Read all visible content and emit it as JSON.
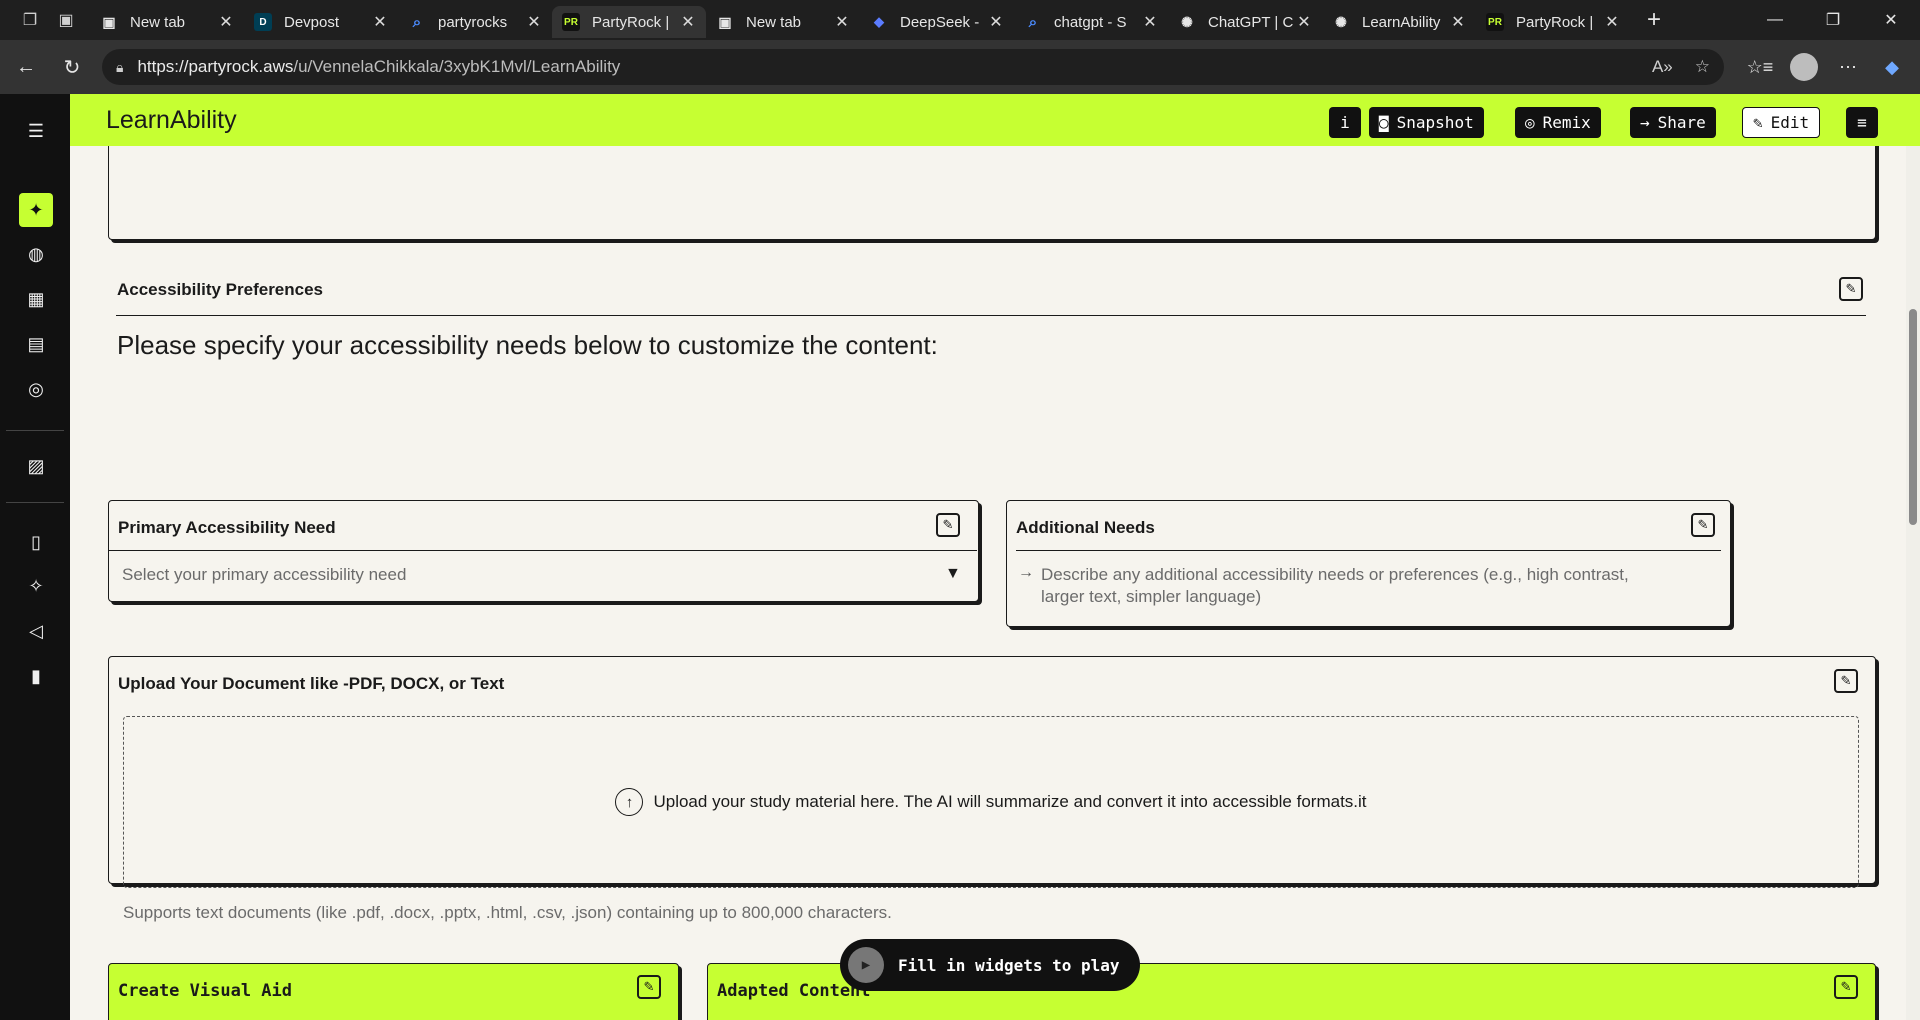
{
  "browser": {
    "tabs": [
      {
        "title": "New tab",
        "favicon": "newtab-icon",
        "active": false
      },
      {
        "title": "Devpost",
        "favicon": "D",
        "active": false
      },
      {
        "title": "partyrocks",
        "favicon": "search-icon",
        "active": false
      },
      {
        "title": "PartyRock |",
        "favicon": "PR",
        "active": true
      },
      {
        "title": "New tab",
        "favicon": "newtab-icon",
        "active": false
      },
      {
        "title": "DeepSeek -",
        "favicon": "deepseek-icon",
        "active": false
      },
      {
        "title": "chatgpt - S",
        "favicon": "search-icon",
        "active": false
      },
      {
        "title": "ChatGPT | C",
        "favicon": "chatgpt-icon",
        "active": false
      },
      {
        "title": "LearnAbility",
        "favicon": "chatgpt-icon",
        "active": false
      },
      {
        "title": "PartyRock |",
        "favicon": "PR",
        "active": false
      }
    ],
    "url_host": "https://partyrock.aws",
    "url_path": "/u/VennelaChikkala/3xybK1Mvl/LearnAbility"
  },
  "app": {
    "title": "LearnAbility",
    "buttons": {
      "info": "i",
      "snapshot": "Snapshot",
      "remix": "Remix",
      "share": "Share",
      "edit": "Edit"
    },
    "accent": "#c6ff32"
  },
  "widgets": {
    "accessibility_preferences": {
      "title": "Accessibility Preferences",
      "heading": "Please specify your accessibility needs below to customize the content:"
    },
    "primary_need": {
      "title": "Primary Accessibility Need",
      "placeholder": "Select your primary accessibility need"
    },
    "additional_needs": {
      "title": "Additional Needs",
      "placeholder_line1": "Describe any additional accessibility needs or preferences (e.g., high contrast,",
      "placeholder_line2": "larger text, simpler language)"
    },
    "upload": {
      "title": "Upload Your Document like -PDF, DOCX, or Text",
      "dropzone_text": "Upload your study material here. The AI will summarize and convert it into accessible formats.it",
      "support_text": "Supports text documents (like .pdf, .docx, .pptx, .html, .csv, .json) containing up to 800,000 characters."
    },
    "visual_aid": {
      "title": "Create Visual Aid"
    },
    "adapted_content": {
      "title": "Adapted Content"
    }
  },
  "play_button": {
    "label": "Fill in widgets to play"
  }
}
